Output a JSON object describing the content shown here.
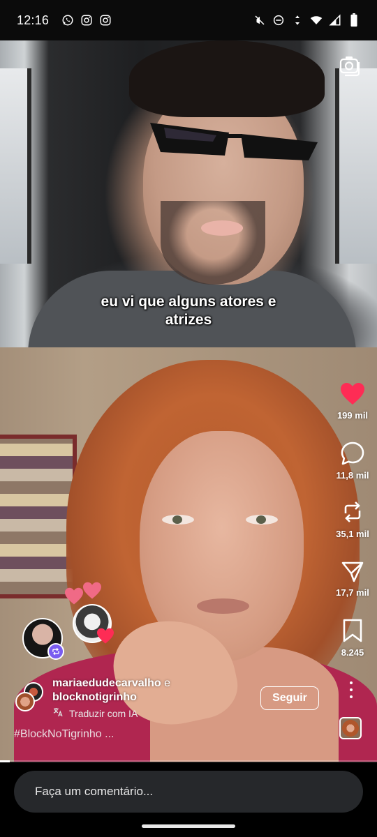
{
  "status_bar": {
    "time": "12:16",
    "left_icons": [
      "whatsapp-icon",
      "instagram-icon",
      "instagram-icon"
    ],
    "right_icons": [
      "mute-icon",
      "dnd-icon",
      "data-arrows-icon",
      "wifi-icon",
      "signal-icon",
      "battery-icon"
    ]
  },
  "top_video": {
    "caption": "eu vi que alguns atores e atrizes",
    "camera_icon": "camera-switch-icon"
  },
  "actions": {
    "like_count": "199 mil",
    "comment_count": "11,8 mil",
    "repost_count": "35,1 mil",
    "share_count": "17,7 mil",
    "save_count": "8.245",
    "like_color": "#fe2c55"
  },
  "post": {
    "author_1": "mariaedudecarvalho",
    "connector": " e",
    "author_2": "blocknotigrinho",
    "follow_label": "Seguir",
    "translate_label": "Traduzir com IA",
    "hashtag": "#BlockNoTigrinho ..."
  },
  "comment_bar": {
    "placeholder": "Faça um comentário..."
  }
}
